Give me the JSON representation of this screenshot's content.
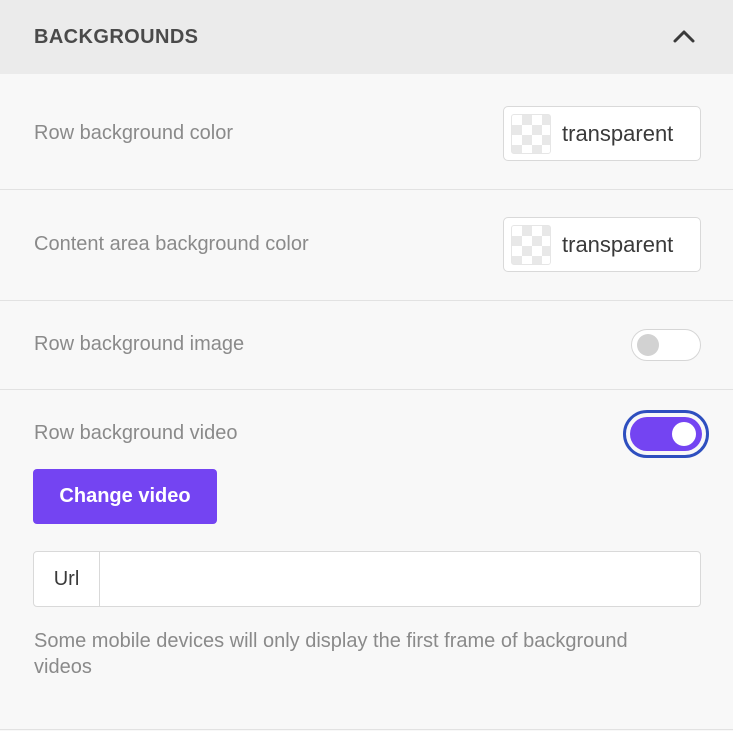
{
  "section": {
    "title": "BACKGROUNDS",
    "collapse_icon": "chevron-up-icon"
  },
  "rows": {
    "row_bg_color": {
      "label": "Row background color",
      "value": "transparent"
    },
    "content_bg_color": {
      "label": "Content area background color",
      "value": "transparent"
    },
    "row_bg_image": {
      "label": "Row background image",
      "enabled": false
    },
    "row_bg_video": {
      "label": "Row background video",
      "enabled": true,
      "button_label": "Change video",
      "url_label": "Url",
      "url_value": "",
      "help_text": "Some mobile devices will only display the first frame of background videos"
    }
  },
  "colors": {
    "accent": "#7444f2",
    "focus_ring": "#2e4fbf",
    "header_bg": "#ebebeb",
    "panel_bg": "#f8f8f8"
  }
}
